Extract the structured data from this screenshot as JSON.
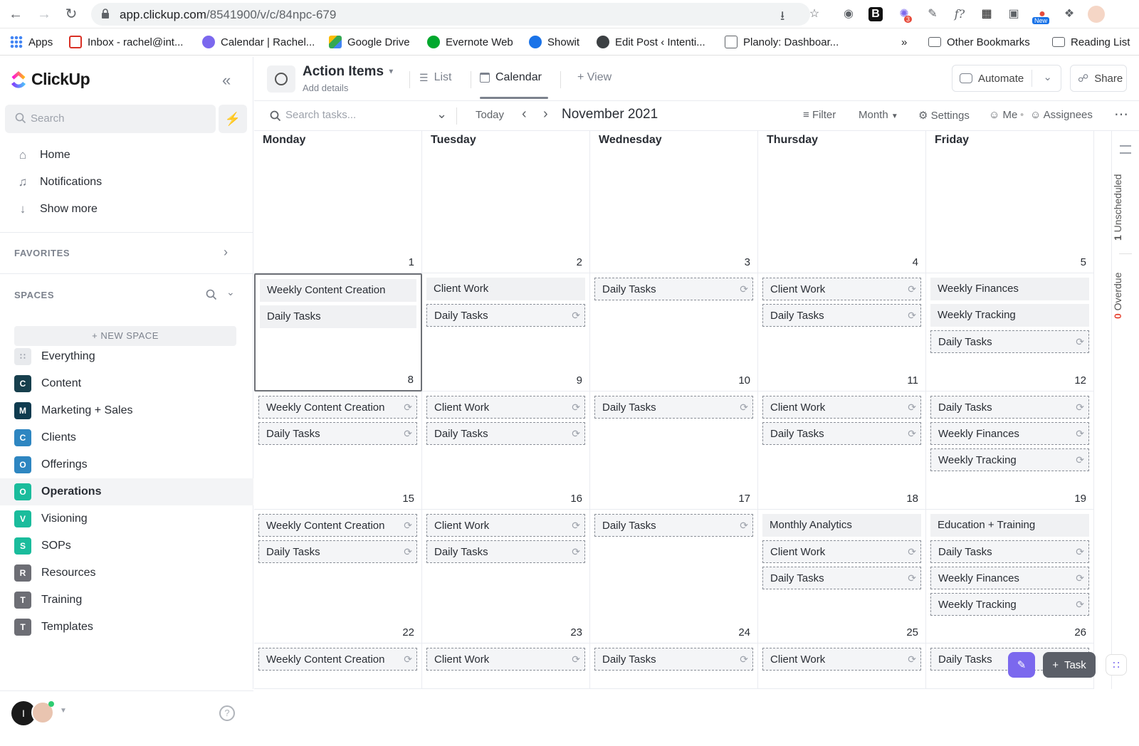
{
  "browser": {
    "url_host": "app.clickup.com",
    "url_path": "/8541900/v/c/84npc-679",
    "extension_badge_count": "3",
    "extension_badge_new": "New",
    "bookmarks": [
      {
        "label": "Apps",
        "color": "#ea4335"
      },
      {
        "label": "Inbox - rachel@int...",
        "color": "#d93025"
      },
      {
        "label": "Calendar | Rachel...",
        "color": "#7b68ee"
      },
      {
        "label": "Google Drive",
        "color": "#34a853"
      },
      {
        "label": "Evernote Web",
        "color": "#00a82d"
      },
      {
        "label": "Showit",
        "color": "#1a73e8"
      },
      {
        "label": "Edit Post ‹ Intenti...",
        "color": "#3c4043"
      },
      {
        "label": "Planoly: Dashboar...",
        "color": "#5f6368"
      }
    ],
    "more_bookmarks": "»",
    "other_bookmarks": "Other Bookmarks",
    "reading_list": "Reading List"
  },
  "sidebar": {
    "logo_text": "ClickUp",
    "search_placeholder": "Search",
    "nav": [
      {
        "label": "Home",
        "icon": "home-icon"
      },
      {
        "label": "Notifications",
        "icon": "bell-icon"
      },
      {
        "label": "Show more",
        "icon": "arrow-down-icon"
      }
    ],
    "favorites_label": "FAVORITES",
    "spaces_label": "SPACES",
    "new_space_label": "+ NEW SPACE",
    "spaces": [
      {
        "label": "Everything",
        "badge": "",
        "color": "#e8eaed"
      },
      {
        "label": "Content",
        "badge": "C",
        "color": "#173f4d"
      },
      {
        "label": "Marketing + Sales",
        "badge": "M",
        "color": "#0f3b4f"
      },
      {
        "label": "Clients",
        "badge": "C",
        "color": "#2e86c1"
      },
      {
        "label": "Offerings",
        "badge": "O",
        "color": "#2e86c1"
      },
      {
        "label": "Operations",
        "badge": "O",
        "color": "#1abc9c",
        "active": true
      },
      {
        "label": "Visioning",
        "badge": "V",
        "color": "#1abc9c"
      },
      {
        "label": "SOPs",
        "badge": "S",
        "color": "#1abc9c"
      },
      {
        "label": "Resources",
        "badge": "R",
        "color": "#6d6e75"
      },
      {
        "label": "Training",
        "badge": "T",
        "color": "#6d6e75"
      },
      {
        "label": "Templates",
        "badge": "T",
        "color": "#6d6e75"
      }
    ],
    "avatar_initial": "I",
    "help": "?"
  },
  "header": {
    "title": "Action Items",
    "subtitle": "Add details",
    "tabs": [
      {
        "label": "List",
        "icon": "list-icon"
      },
      {
        "label": "Calendar",
        "icon": "calendar-icon"
      },
      {
        "label": "+ View",
        "icon": ""
      }
    ],
    "automate": "Automate",
    "share": "Share"
  },
  "toolbar": {
    "search_placeholder": "Search tasks...",
    "today": "Today",
    "month_title": "November 2021",
    "filter": "Filter",
    "view_mode": "Month",
    "settings": "Settings",
    "me": "Me",
    "assignees": "Assignees"
  },
  "calendar": {
    "days": [
      "Monday",
      "Tuesday",
      "Wednesday",
      "Thursday",
      "Friday"
    ],
    "weeks": [
      {
        "dates": [
          "1",
          "2",
          "3",
          "4",
          "5"
        ],
        "tasks": [
          [],
          [],
          [],
          [],
          []
        ]
      },
      {
        "dates": [
          "8",
          "9",
          "10",
          "11",
          "12"
        ],
        "tasks": [
          [
            {
              "t": "Weekly Content Creation",
              "r": false
            },
            {
              "t": "Daily Tasks",
              "r": false
            }
          ],
          [
            {
              "t": "Client Work",
              "r": false
            },
            {
              "t": "Daily Tasks",
              "r": true
            }
          ],
          [
            {
              "t": "Daily Tasks",
              "r": true
            }
          ],
          [
            {
              "t": "Client Work",
              "r": true
            },
            {
              "t": "Daily Tasks",
              "r": true
            }
          ],
          [
            {
              "t": "Weekly Finances",
              "r": false
            },
            {
              "t": "Weekly Tracking",
              "r": false
            },
            {
              "t": "Daily Tasks",
              "r": true
            }
          ]
        ]
      },
      {
        "dates": [
          "15",
          "16",
          "17",
          "18",
          "19"
        ],
        "tasks": [
          [
            {
              "t": "Weekly Content Creation",
              "r": true
            },
            {
              "t": "Daily Tasks",
              "r": true
            }
          ],
          [
            {
              "t": "Client Work",
              "r": true
            },
            {
              "t": "Daily Tasks",
              "r": true
            }
          ],
          [
            {
              "t": "Daily Tasks",
              "r": true
            }
          ],
          [
            {
              "t": "Client Work",
              "r": true
            },
            {
              "t": "Daily Tasks",
              "r": true
            }
          ],
          [
            {
              "t": "Daily Tasks",
              "r": true
            },
            {
              "t": "Weekly Finances",
              "r": true
            },
            {
              "t": "Weekly Tracking",
              "r": true
            }
          ]
        ]
      },
      {
        "dates": [
          "22",
          "23",
          "24",
          "25",
          "26"
        ],
        "tasks": [
          [
            {
              "t": "Weekly Content Creation",
              "r": true
            },
            {
              "t": "Daily Tasks",
              "r": true
            }
          ],
          [
            {
              "t": "Client Work",
              "r": true
            },
            {
              "t": "Daily Tasks",
              "r": true
            }
          ],
          [
            {
              "t": "Daily Tasks",
              "r": true
            }
          ],
          [
            {
              "t": "Monthly Analytics",
              "r": false
            },
            {
              "t": "Client Work",
              "r": true
            },
            {
              "t": "Daily Tasks",
              "r": true
            }
          ],
          [
            {
              "t": "Education + Training",
              "r": false
            },
            {
              "t": "Daily Tasks",
              "r": true
            },
            {
              "t": "Weekly Finances",
              "r": true
            },
            {
              "t": "Weekly Tracking",
              "r": true
            }
          ]
        ]
      },
      {
        "dates": [
          "",
          "",
          "",
          "",
          ""
        ],
        "tasks": [
          [
            {
              "t": "Weekly Content Creation",
              "r": true
            }
          ],
          [
            {
              "t": "Client Work",
              "r": true
            }
          ],
          [
            {
              "t": "Daily Tasks",
              "r": true
            }
          ],
          [
            {
              "t": "Client Work",
              "r": true
            }
          ],
          [
            {
              "t": "Daily Tasks",
              "r": true
            }
          ]
        ]
      }
    ],
    "unscheduled_count": "1",
    "unscheduled_label": "Unscheduled",
    "overdue_count": "0",
    "overdue_label": "Overdue"
  },
  "fab": {
    "task": "Task"
  },
  "colors": {
    "accent": "#7b68ee",
    "overdue": "#e74c3c"
  }
}
